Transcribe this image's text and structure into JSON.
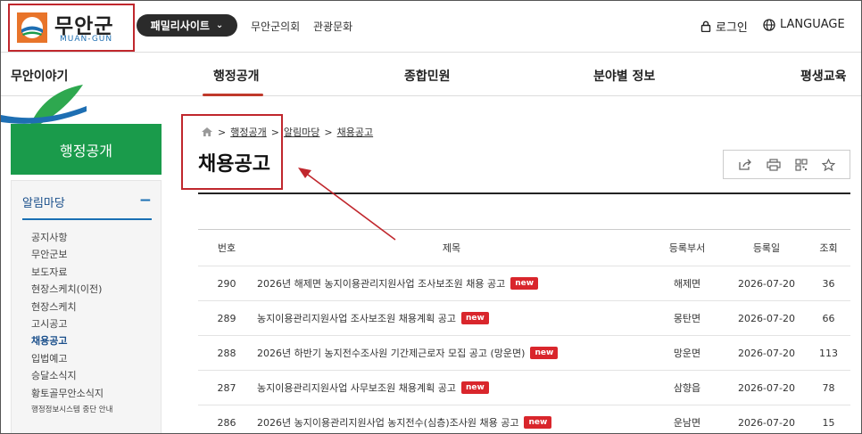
{
  "header": {
    "logo_text": "무안군",
    "logo_sub": "MUAN-GUN",
    "family_site": "패밀리사이트",
    "links": [
      "무안군의회",
      "관광문화"
    ],
    "login": "로그인",
    "language": "LANGUAGE"
  },
  "gnb": {
    "items": [
      "무안이야기",
      "행정공개",
      "종합민원",
      "분야별 정보",
      "평생교육"
    ]
  },
  "sidebar": {
    "title": "행정공개",
    "section": "알림마당",
    "items": [
      {
        "label": "공지사항"
      },
      {
        "label": "무안군보"
      },
      {
        "label": "보도자료"
      },
      {
        "label": "현장스케치(이전)"
      },
      {
        "label": "현장스케치"
      },
      {
        "label": "고시공고"
      },
      {
        "label": "채용공고"
      },
      {
        "label": "입법예고"
      },
      {
        "label": "승달소식지"
      },
      {
        "label": "황토골무안소식지"
      },
      {
        "label": "행정정보시스템 중단 안내"
      }
    ]
  },
  "breadcrumb": [
    "행정공개",
    "알림마당",
    "채용공고"
  ],
  "page_title": "채용공고",
  "table": {
    "headers": [
      "번호",
      "제목",
      "등록부서",
      "등록일",
      "조회"
    ],
    "badge": "new",
    "rows": [
      {
        "num": "290",
        "title": "2026년 해제면 농지이용관리지원사업 조사보조원 채용 공고",
        "dept": "해제면",
        "date": "2026-07-20",
        "views": "36"
      },
      {
        "num": "289",
        "title": "농지이용관리지원사업 조사보조원 채용계획 공고",
        "dept": "몽탄면",
        "date": "2026-07-20",
        "views": "66"
      },
      {
        "num": "288",
        "title": "2026년 하반기 농지전수조사원 기간제근로자 모집 공고 (망운면)",
        "dept": "망운면",
        "date": "2026-07-20",
        "views": "113"
      },
      {
        "num": "287",
        "title": "농지이용관리지원사업 사무보조원 채용계획 공고",
        "dept": "삼향읍",
        "date": "2026-07-20",
        "views": "78"
      },
      {
        "num": "286",
        "title": "2026년 농지이용관리지원사업 농지전수(심층)조사원 채용 공고",
        "dept": "운남면",
        "date": "2026-07-20",
        "views": "15"
      }
    ]
  },
  "colors": {
    "accent_green": "#1a9b4b",
    "highlight_red": "#c0272d",
    "badge_red": "#d9262c",
    "nav_blue": "#1a6fb3"
  },
  "icons": [
    "home-icon",
    "lock-icon",
    "globe-icon",
    "share-icon",
    "print-icon",
    "qr-icon",
    "star-icon"
  ]
}
